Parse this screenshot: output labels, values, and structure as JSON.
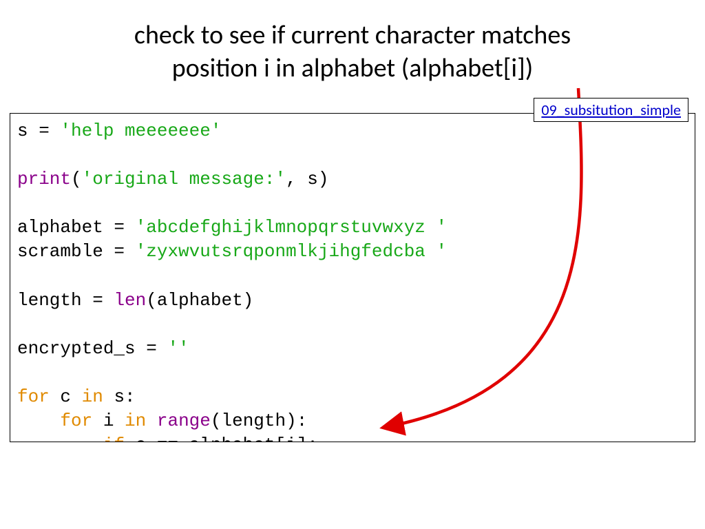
{
  "title_line1": "check to see if  current character matches",
  "title_line2": "position i in alphabet (alphabet[i])",
  "link_label": "09_subsitution_simple",
  "code": {
    "l1a": "s = ",
    "l1b": "'help meeeeeee'",
    "l3a": "print",
    "l3b": "(",
    "l3c": "'original message:'",
    "l3d": ", s)",
    "l5a": "alphabet = ",
    "l5b": "'abcdefghijklmnopqrstuvwxyz '",
    "l6a": "scramble = ",
    "l6b": "'zyxwvutsrqponmlkjihgfedcba '",
    "l8a": "length = ",
    "l8b": "len",
    "l8c": "(alphabet)",
    "l10a": "encrypted_s = ",
    "l10b": "''",
    "l12a": "for",
    "l12b": " c ",
    "l12c": "in",
    "l12d": " s:",
    "l13a": "    ",
    "l13b": "for",
    "l13c": " i ",
    "l13d": "in",
    "l13e": " ",
    "l13f": "range",
    "l13g": "(length):",
    "l14a": "        ",
    "l14b": "if",
    "l14c": " c == alphabet[i]:"
  }
}
